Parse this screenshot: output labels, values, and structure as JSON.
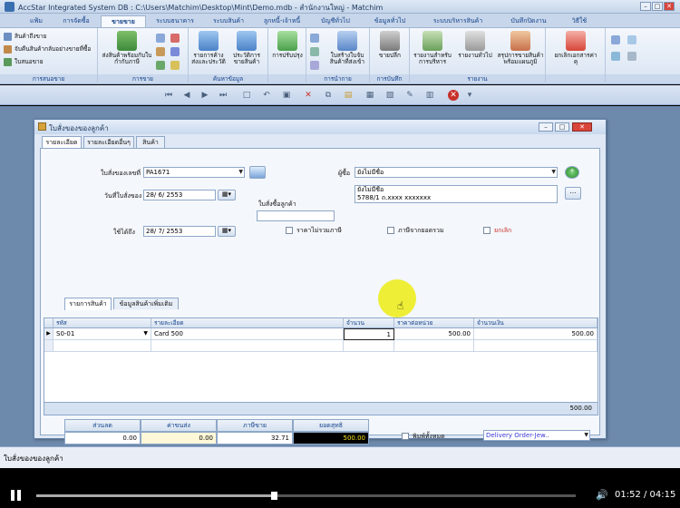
{
  "window": {
    "title": "AccStar Integrated System DB : C:\\Users\\Matchim\\Desktop\\Mint\\Demo.mdb - สำนักงานใหญ่ - Matchim",
    "minimize": "–",
    "maximize": "□",
    "close": "✕"
  },
  "ribbon_tabs": [
    "แฟ้ม",
    "การจัดซื้อ",
    "ขายขาย",
    "ระบบธนาคาร",
    "ระบบสินค้า",
    "ลูกหนี้-เจ้าหนี้",
    "บัญชีทั่วไป",
    "ข้อมูลทั่วไป",
    "ระบบบริหารสินค้า",
    "บันทึกปิดงาน",
    "วิธีใช้"
  ],
  "ribbon": {
    "groups": [
      {
        "label": "การสนอขาย",
        "items": [
          "สินค้าถึงขาย",
          "จับคืนสินค้ากลับอย่างขายที่ซื้อ",
          "ใบสนอขาย"
        ]
      },
      {
        "label": "การขาย",
        "items": [
          "ส่งสินค้าพร้อมกับใบกำกับภาษี"
        ]
      },
      {
        "label": "ค้นหาข้อมูล",
        "items": [
          "รายการค้างส่งและประวัติ",
          "ประวัติการขายสินค้า"
        ]
      },
      {
        "label": "",
        "items": [
          "การปรับปรุง"
        ]
      },
      {
        "label": "การนำกาย",
        "items": [
          "ใบสร้างใบจับสินค้าที่ส่งเข้า"
        ]
      },
      {
        "label": "การบันทึก",
        "items": [
          "ขายปลีก"
        ]
      },
      {
        "label": "รายงาน",
        "items": [
          "รายงานสำหรับการบริหาร",
          "รายงานทั่วไป",
          "สรุปการขายสินค้าพร้อมแผนภูมิ"
        ]
      },
      {
        "label": "",
        "items": [
          "ยกเลิกเอกสารค่าคุ"
        ]
      }
    ]
  },
  "child_window": {
    "title": "ใบสั่งของของลูกค้า",
    "tabs": [
      "รายละเอียด",
      "รายละเอียดอื่นๆ",
      "สินค้า"
    ],
    "labels": {
      "order_no": "ใบสั่งของเลขที่",
      "order_date": "วันที่ใบสั่งของ",
      "customer_ref": "ใบสั่งซื้อลูกค้า",
      "due_date": "ใช้ได้ถึง",
      "customer": "ผู้ซื้อ",
      "vat_excluded": "ราคาไม่รวมภาษี",
      "vat_cash": "ภาษีจากยอดรวม",
      "cancel": "ยกเลิก"
    },
    "values": {
      "order_no": "PA1671",
      "order_date": "28/ 6/ 2553",
      "due_date": "28/ 7/ 2553",
      "customer": "ยังไม่มีชื่อ",
      "customer_address_1": "ยังไม่มีชื่อ",
      "customer_address_2": "5788/1 ถ.xxxx xxxxxxx"
    },
    "sub_tabs": [
      "รายการสินค้า",
      "ข้อมูลสินค้าเพิ่มเติม"
    ],
    "grid": {
      "columns": [
        "รหัส",
        "รายละเอียด",
        "จำนวน",
        "ราคาต่อหน่วย",
        "จำนวนเงิน"
      ],
      "rows": [
        {
          "code": "S0-01",
          "desc": "Card 500",
          "qty": "1",
          "price": "500.00",
          "amount": "500.00"
        }
      ],
      "total": "500.00"
    },
    "summary": {
      "headers": [
        "ส่วนลด",
        "ค่าขนส่ง",
        "ภาษีขาย",
        "ยอดสุทธิ"
      ],
      "values": [
        "0.00",
        "0.00",
        "32.71",
        "500.00"
      ],
      "include_vat": "พิมพ์ทั้งหมด",
      "print_form": "Delivery Order-Jew.."
    }
  },
  "status_bar": {
    "text": "ใบสั่งของของลูกค้า"
  },
  "player": {
    "time": "01:52 / 04:15",
    "progress": 0.44
  }
}
